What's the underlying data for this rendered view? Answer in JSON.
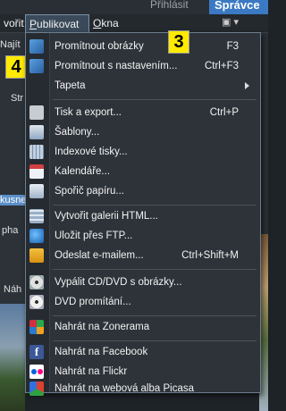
{
  "topbar": {
    "tab_login": "Přihlásit",
    "tab_manager": "Správce"
  },
  "menubar": {
    "left_partial": "vořit",
    "publikovat": "Publikovat",
    "okna": "Okna"
  },
  "left_panel": {
    "najit": "Najít",
    "str": "Str",
    "kusne": "kusne",
    "pha": "pha",
    "nah": "Náh"
  },
  "badges": {
    "b4": "4",
    "b3": "3"
  },
  "menu": {
    "items": [
      {
        "label": "Promítnout obrázky",
        "shortcut": "F3",
        "icon": "projector-icon"
      },
      {
        "label": "Promítnout s nastavením...",
        "shortcut": "Ctrl+F3",
        "icon": "projector-settings-icon"
      },
      {
        "label": "Tapeta",
        "shortcut": "",
        "icon": "",
        "submenu": true
      },
      {
        "label": "Tisk a export...",
        "shortcut": "Ctrl+P",
        "icon": "printer-icon"
      },
      {
        "label": "Šablony...",
        "shortcut": "",
        "icon": "templates-icon"
      },
      {
        "label": "Indexové tisky...",
        "shortcut": "",
        "icon": "index-prints-icon"
      },
      {
        "label": "Kalendáře...",
        "shortcut": "",
        "icon": "calendar-icon"
      },
      {
        "label": "Spořič papíru...",
        "shortcut": "",
        "icon": "paper-saver-icon"
      },
      {
        "label": "Vytvořit galerii HTML...",
        "shortcut": "",
        "icon": "html-gallery-icon"
      },
      {
        "label": "Uložit přes FTP...",
        "shortcut": "",
        "icon": "ftp-globe-icon"
      },
      {
        "label": "Odeslat e-mailem...",
        "shortcut": "Ctrl+Shift+M",
        "icon": "email-envelope-icon"
      },
      {
        "label": "Vypálit CD/DVD s obrázky...",
        "shortcut": "",
        "icon": "cd-burn-icon"
      },
      {
        "label": "DVD promítání...",
        "shortcut": "",
        "icon": "dvd-slideshow-icon"
      },
      {
        "label": "Nahrát na Zonerama",
        "shortcut": "",
        "icon": "zonerama-icon"
      },
      {
        "label": "Nahrát na Facebook",
        "shortcut": "",
        "icon": "facebook-icon"
      },
      {
        "label": "Nahrát na Flickr",
        "shortcut": "",
        "icon": "flickr-icon"
      },
      {
        "label": "Nahrát na webová alba Picasa",
        "shortcut": "",
        "icon": "picasa-icon"
      }
    ]
  },
  "facebook_glyph": "f"
}
